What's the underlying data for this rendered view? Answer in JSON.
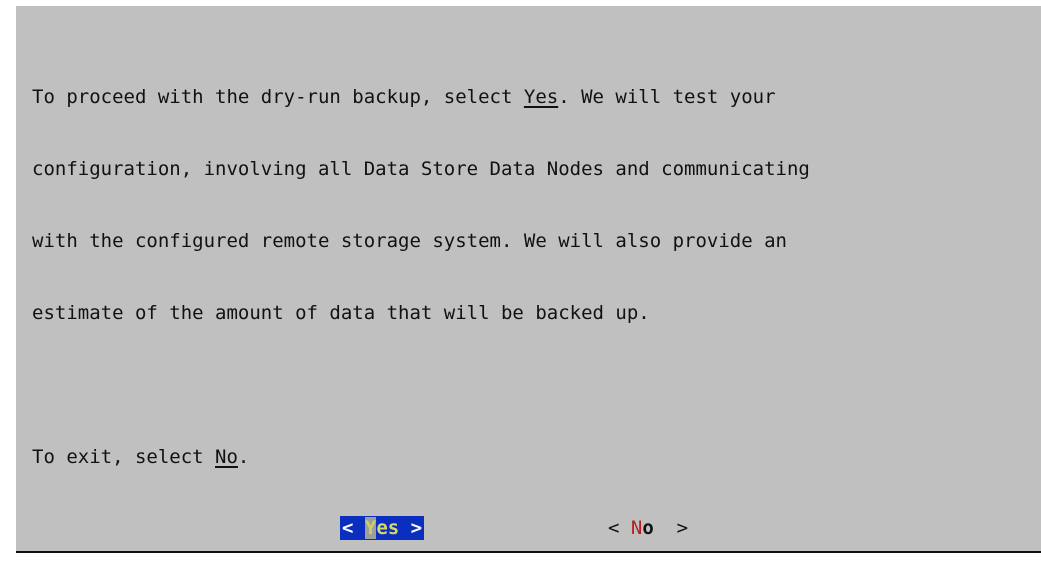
{
  "message": {
    "line1_pre": "To proceed with the dry-run backup, select ",
    "line1_link": "Yes",
    "line1_post": ". We will test your",
    "line2": "configuration, involving all Data Store Data Nodes and communicating",
    "line3": "with the configured remote storage system. We will also provide an",
    "line4": "estimate of the amount of data that will be backed up.",
    "line6_pre": "To exit, select ",
    "line6_link": "No",
    "line6_post": "."
  },
  "buttons": {
    "yes": {
      "left_bracket": "< ",
      "hotkey": "Y",
      "rest": "es",
      "right_bracket": " >"
    },
    "no": {
      "left_bracket": "< ",
      "hotkey": "N",
      "rest": "o",
      "right_bracket": "  >"
    }
  },
  "colors": {
    "background": "#c0c0c0",
    "selected_button": "#0a2ebd",
    "hotkey_red": "#b41e1e"
  }
}
